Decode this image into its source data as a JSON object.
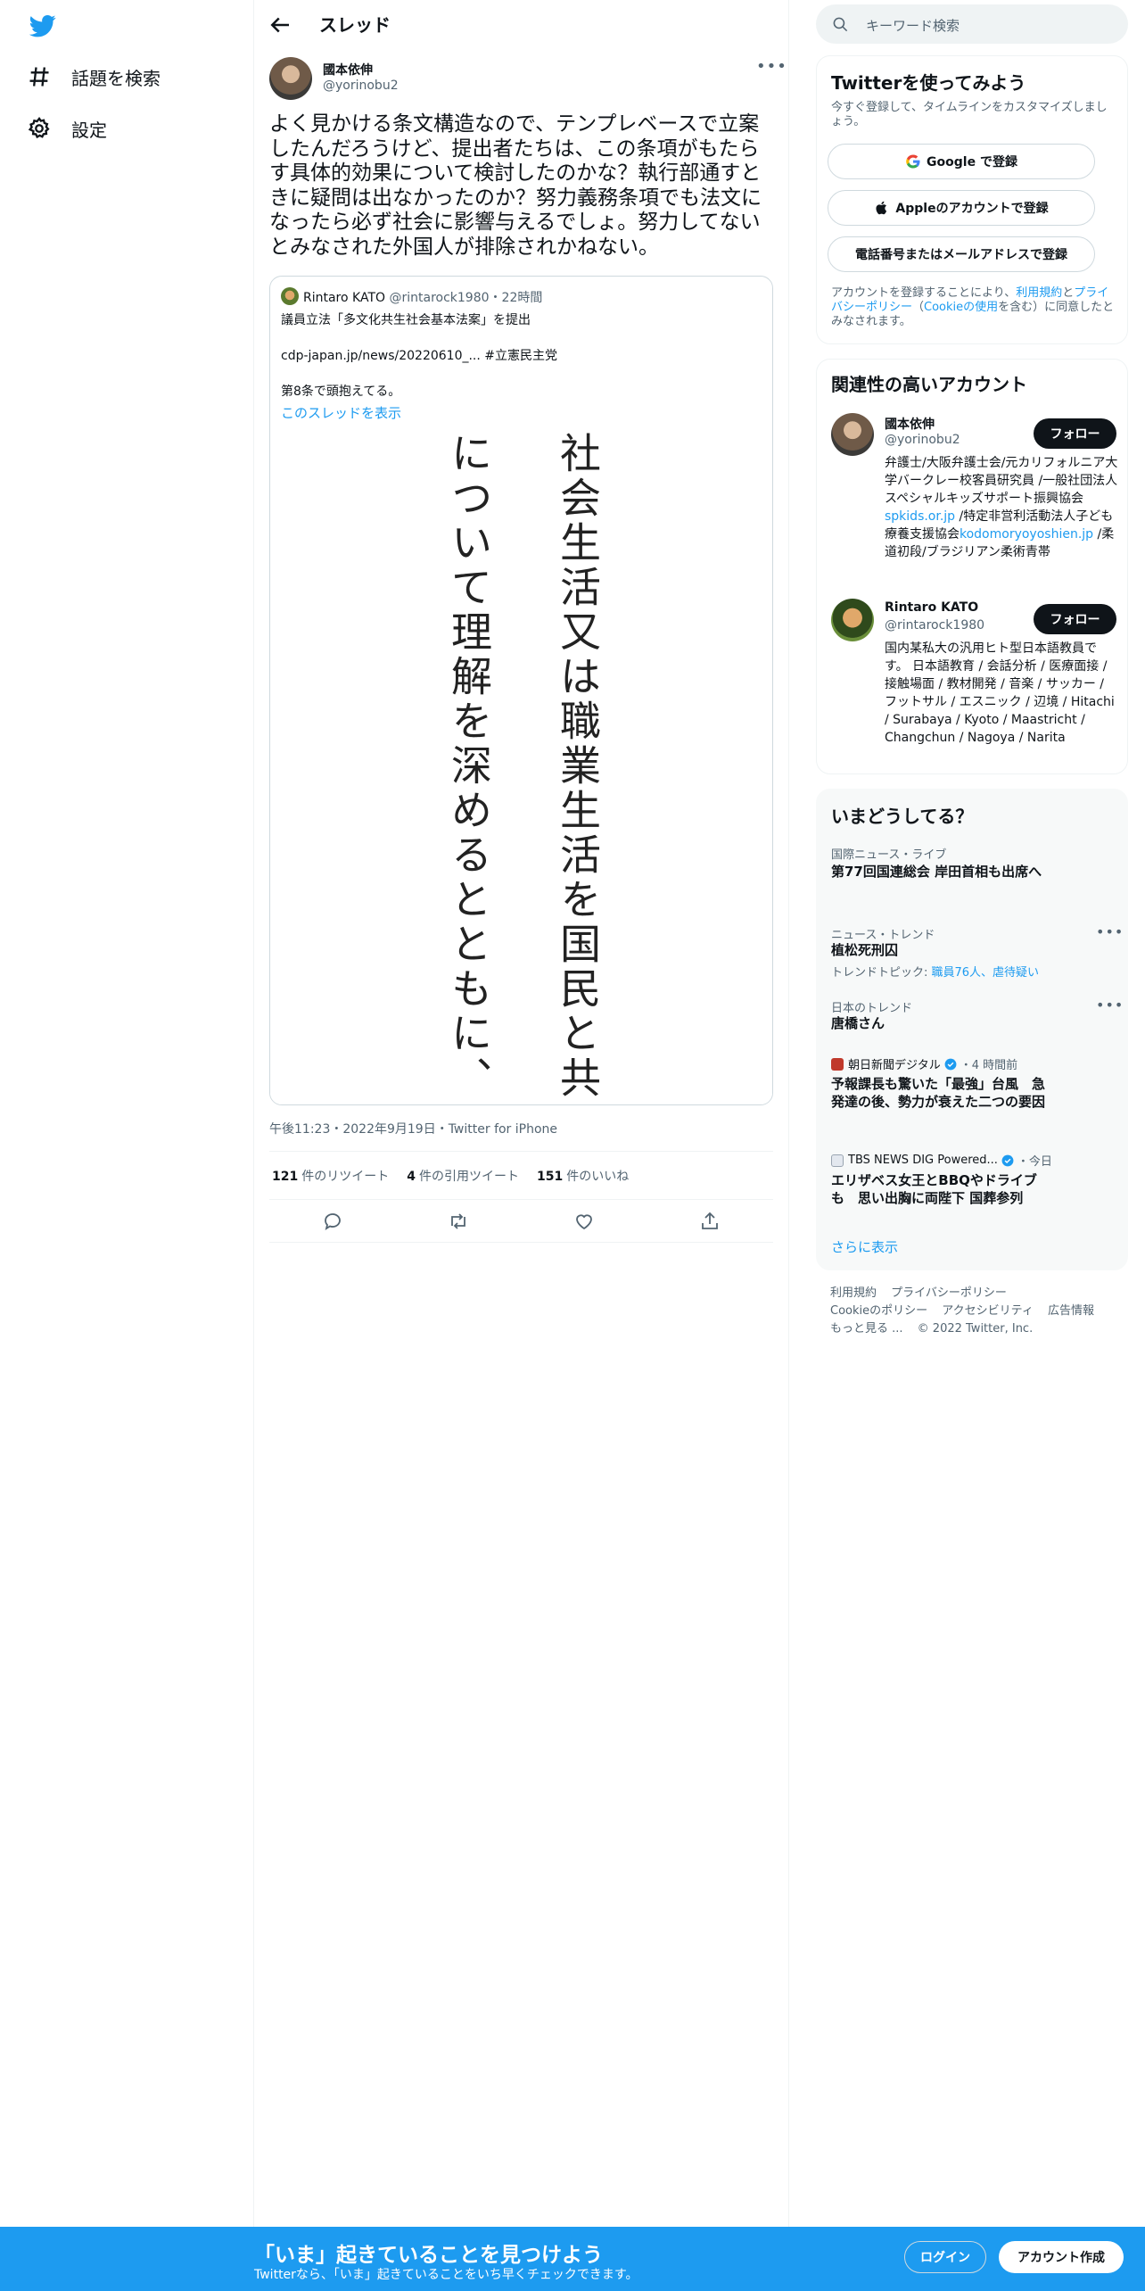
{
  "nav": {
    "items": [
      {
        "label": "話題を検索",
        "icon": "hashtag-icon"
      },
      {
        "label": "設定",
        "icon": "gear-icon"
      }
    ]
  },
  "header": {
    "title": "スレッド"
  },
  "tweet": {
    "author_name": "國本依伸",
    "author_handle": "@yorinobu2",
    "text": "よく見かける条文構造なので、テンプレベースで立案したんだろうけど、提出者たちは、この条項がもたらす具体的効果について検討したのかな？執行部通すときに疑問は出なかったのか？努力義務条項でも法文になったら必ず社会に影響与えるでしょ。努力してないとみなされた外国人が排除されかねない。",
    "time": "午後11:23・2022年9月19日・Twitter for iPhone",
    "retweets": "121",
    "retweets_label": "件のリツイート",
    "quotes": "4",
    "quotes_label": "件の引用ツイート",
    "likes": "151",
    "likes_label": "件のいいね"
  },
  "quote": {
    "name": "Rintaro KATO",
    "handle": "@rintarock1980",
    "time": "・22時間",
    "line1": "議員立法「多文化共生社会基本法案」を提出",
    "line2": "cdp-japan.jp/news/20220610_... #立憲民主党",
    "line3": "第8条で頭抱えてる。",
    "thread_link": "このスレッドを表示",
    "image_col1": "社会生活又は職業生活を国民と共",
    "image_col2": "について理解を深めるとともに、"
  },
  "search": {
    "placeholder": "キーワード検索"
  },
  "signup_card": {
    "title": "Twitterを使ってみよう",
    "subtitle": "今すぐ登録して、タイムラインをカスタマイズしましょう。",
    "google": "Google で登録",
    "apple": "Appleのアカウントで登録",
    "phone": "電話番号またはメールアドレスで登録",
    "terms_pre": "アカウントを登録することにより、",
    "terms_link1": "利用規約",
    "terms_mid": "と",
    "terms_link2": "プライバシーポリシー",
    "terms_paren1": "（",
    "terms_link3": "Cookieの使用",
    "terms_post": "を含む）に同意したとみなされます。"
  },
  "related": {
    "title": "関連性の高いアカウント",
    "follow_label": "フォロー",
    "accounts": [
      {
        "name": "國本依伸",
        "handle": "@yorinobu2",
        "bio_a": "弁護士/大阪弁護士会/元カリフォルニア大学バークレー校客員研究員 /一般社団法人スペシャルキッズサポート振興協会",
        "bio_link1": "spkids.or.jp",
        "bio_b": " /特定非営利活動法人子ども療養支援協会",
        "bio_link2": "kodomoryoyoshien.jp",
        "bio_c": " /柔道初段/ブラジリアン柔術青帯"
      },
      {
        "name": "Rintaro KATO",
        "handle": "@rintarock1980",
        "bio_a": "国内某私大の汎用ヒト型日本語教員です。 日本語教育 / 会話分析 / 医療面接 / 接触場面 / 教材開発 / 音楽 / サッカー / フットサル / エスニック / 辺境 / Hitachi / Surabaya / Kyoto / Maastricht / Changchun / Nagoya / Narita"
      }
    ]
  },
  "trends": {
    "title": "いまどうしてる？",
    "items": [
      {
        "category": "国際ニュース・ライブ",
        "title": "第77回国連総会 岸田首相も出席へ"
      },
      {
        "category": "ニュース・トレンド",
        "title": "植松死刑囚",
        "sub_pre": "トレンドトピック: ",
        "sub_link": "職員76人、虐待疑い"
      },
      {
        "category": "日本のトレンド",
        "title": "唐橋さん"
      },
      {
        "source": "朝日新聞デジタル",
        "age": "・4 時間前",
        "title": "予報課長も驚いた「最強」台風　急発達の後、勢力が衰えた二つの要因"
      },
      {
        "source": "TBS NEWS DIG Powered...",
        "age": "・今日",
        "title": "エリザベス女王とBBQやドライブも　思い出胸に両陛下 国葬参列"
      }
    ],
    "show_more": "さらに表示"
  },
  "footer": {
    "links": [
      "利用規約",
      "プライバシーポリシー",
      "Cookieのポリシー",
      "アクセシビリティ",
      "広告情報",
      "もっと見る ..."
    ],
    "copyright": "© 2022 Twitter, Inc."
  },
  "bottom_bar": {
    "title": "「いま」起きていることを見つけよう",
    "subtitle": "Twitterなら、「いま」起きていることをいち早くチェックできます。",
    "login": "ログイン",
    "signup": "アカウント作成"
  },
  "colors": {
    "accent": "#1d9bf0",
    "text": "#0f1419",
    "muted": "#536471"
  }
}
